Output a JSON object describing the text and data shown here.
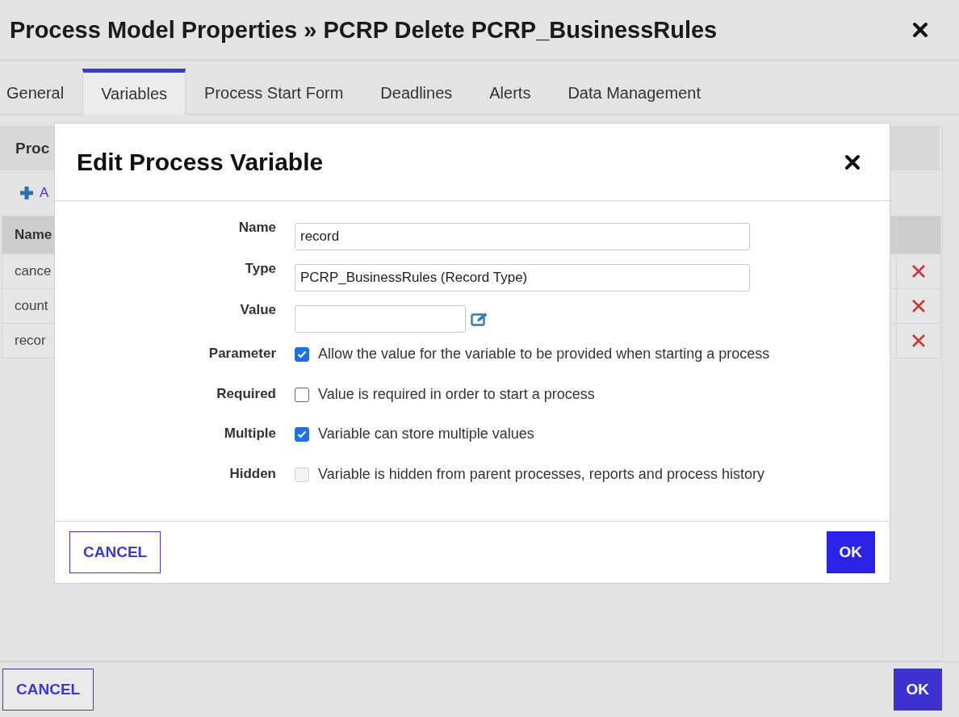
{
  "window": {
    "title": "Process Model Properties » PCRP Delete PCRP_BusinessRules"
  },
  "tabs": [
    {
      "label": "General",
      "selected": false
    },
    {
      "label": "Variables",
      "selected": true
    },
    {
      "label": "Process Start Form",
      "selected": false
    },
    {
      "label": "Deadlines",
      "selected": false
    },
    {
      "label": "Alerts",
      "selected": false
    },
    {
      "label": "Data Management",
      "selected": false
    }
  ],
  "panel": {
    "heading": "Proc",
    "add_link": "A",
    "table": {
      "columns": [
        "Name"
      ],
      "rows": [
        {
          "name": "cance"
        },
        {
          "name": "count"
        },
        {
          "name": "recor"
        }
      ]
    }
  },
  "footer": {
    "cancel": "CANCEL",
    "ok": "OK"
  },
  "dialog": {
    "title": "Edit Process Variable",
    "fields": [
      {
        "label": "Name",
        "kind": "text",
        "value": "record"
      },
      {
        "label": "Type",
        "kind": "text",
        "value": "PCRP_BusinessRules (Record Type)"
      },
      {
        "label": "Value",
        "kind": "expression"
      }
    ],
    "options": [
      {
        "label": "Parameter",
        "text": "Allow the value for the variable to be provided when starting a process",
        "checked": true,
        "disabled": false
      },
      {
        "label": "Required",
        "text": "Value is required in order to start a process",
        "checked": false,
        "disabled": false
      },
      {
        "label": "Multiple",
        "text": "Variable can store multiple values",
        "checked": true,
        "disabled": false
      },
      {
        "label": "Hidden",
        "text": "Variable is hidden from parent processes, reports and process history",
        "checked": false,
        "disabled": true
      }
    ],
    "buttons": {
      "cancel": "CANCEL",
      "ok": "OK"
    }
  }
}
